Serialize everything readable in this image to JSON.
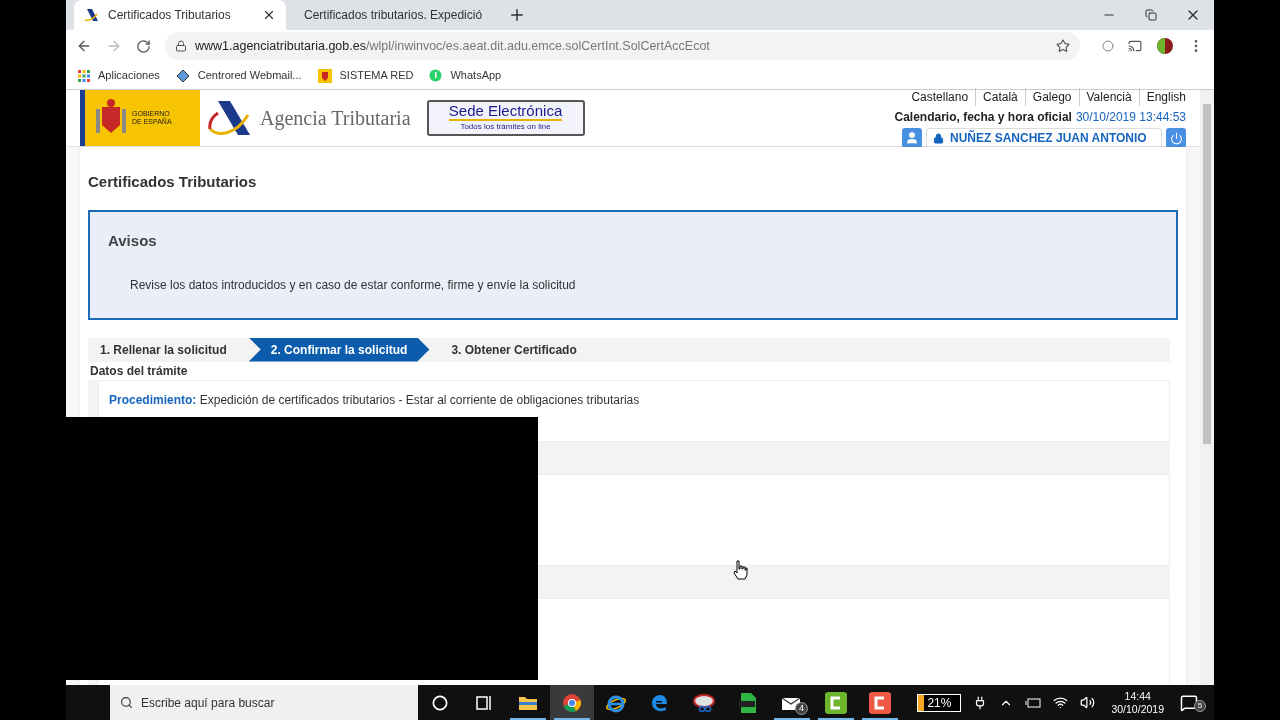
{
  "tabs": [
    {
      "title": "Certificados Tributarios",
      "selected": true
    },
    {
      "title": "Certificados tributarios. Expedició",
      "selected": false
    }
  ],
  "address": {
    "domain": "www1.agenciatributaria.gob.es",
    "path": "/wlpl/inwinvoc/es.aeat.dit.adu.emce.solCertInt.SolCertAccEcot"
  },
  "bookmarks": [
    {
      "label": "Aplicaciones",
      "kind": "apps"
    },
    {
      "label": "Centrored Webmail...",
      "kind": "mail"
    },
    {
      "label": "SISTEMA RED",
      "kind": "crest"
    },
    {
      "label": "WhatsApp",
      "kind": "chat"
    }
  ],
  "header": {
    "government": "GOBIERNO DE ESPAÑA",
    "agency": "Agencia Tributaria",
    "sede_title": "Sede Electrónica",
    "sede_subtitle": "Todos los trámites on line",
    "languages": [
      "Castellano",
      "Català",
      "Galego",
      "Valencià",
      "English"
    ],
    "clock_label": "Calendario, fecha y hora oficial",
    "clock_value": "30/10/2019 13:44:53",
    "user": "NUÑEZ SANCHEZ JUAN ANTONIO"
  },
  "page_title": "Certificados Tributarios",
  "notice": {
    "title": "Avisos",
    "message": "Revise los datos introducidos y en caso de estar conforme, firme y envíe la solicitud"
  },
  "steps": [
    {
      "label": "1. Rellenar la solicitud",
      "selected": false
    },
    {
      "label": "2. Confirmar la solicitud",
      "selected": true
    },
    {
      "label": "3. Obtener Certificado",
      "selected": false
    }
  ],
  "section_title": "Datos del trámite",
  "fields": [
    {
      "label": "Procedimiento:",
      "value": "Expedición de certificados tributarios - Estar al corriente de obligaciones tributarias"
    }
  ],
  "taskbar": {
    "search_placeholder": "Escribe aquí para buscar",
    "apps": [
      {
        "kind": "cortana",
        "running": false
      },
      {
        "kind": "taskview",
        "running": false
      },
      {
        "kind": "explorer",
        "running": true
      },
      {
        "kind": "chrome",
        "running": true
      },
      {
        "kind": "ie",
        "running": false
      },
      {
        "kind": "edge",
        "running": false
      },
      {
        "kind": "snip",
        "running": false
      },
      {
        "kind": "pdf",
        "running": false
      },
      {
        "kind": "mail",
        "running": true,
        "badge": "4"
      },
      {
        "kind": "camtasia",
        "running": true
      },
      {
        "kind": "recorder",
        "running": true
      }
    ],
    "battery": "21%",
    "time": "14:44",
    "date": "30/10/2019",
    "notifications": "5"
  }
}
